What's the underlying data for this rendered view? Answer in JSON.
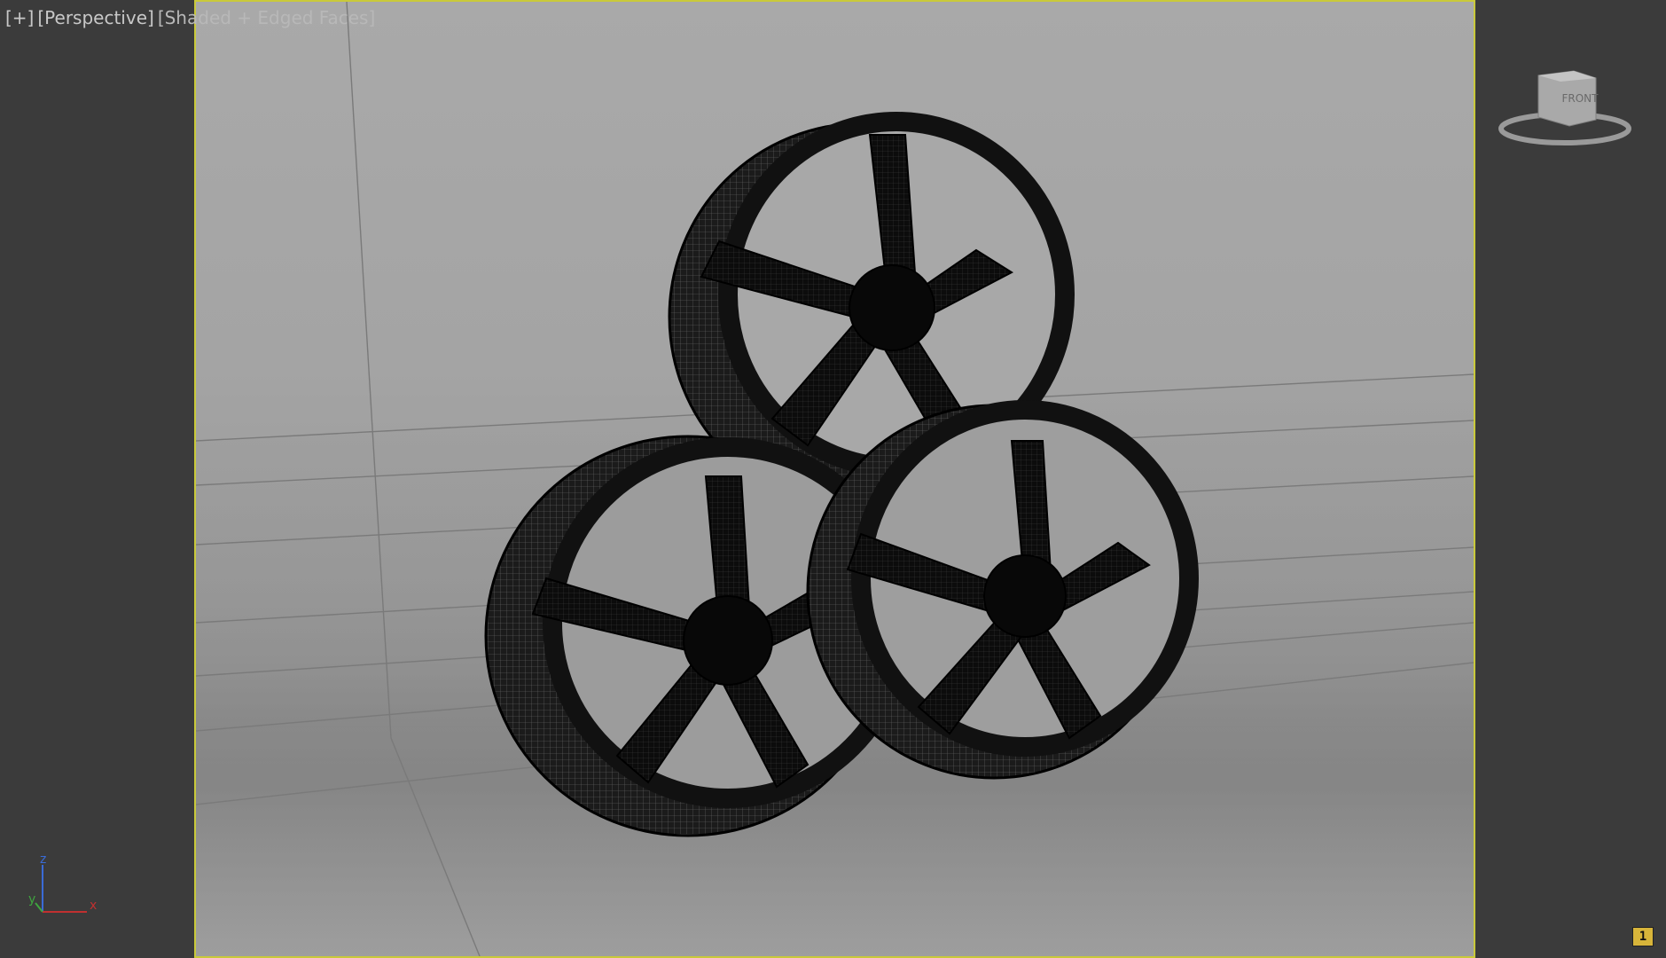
{
  "viewport": {
    "labels": {
      "menu": "[+]",
      "view": "[Perspective]",
      "shading": "[Shaded + Edged Faces]"
    },
    "viewcube_face": "FRONT",
    "axis": {
      "x": "x",
      "y": "y",
      "z": "z"
    },
    "page_indicator": "1",
    "accent_color": "#c9c93a"
  }
}
